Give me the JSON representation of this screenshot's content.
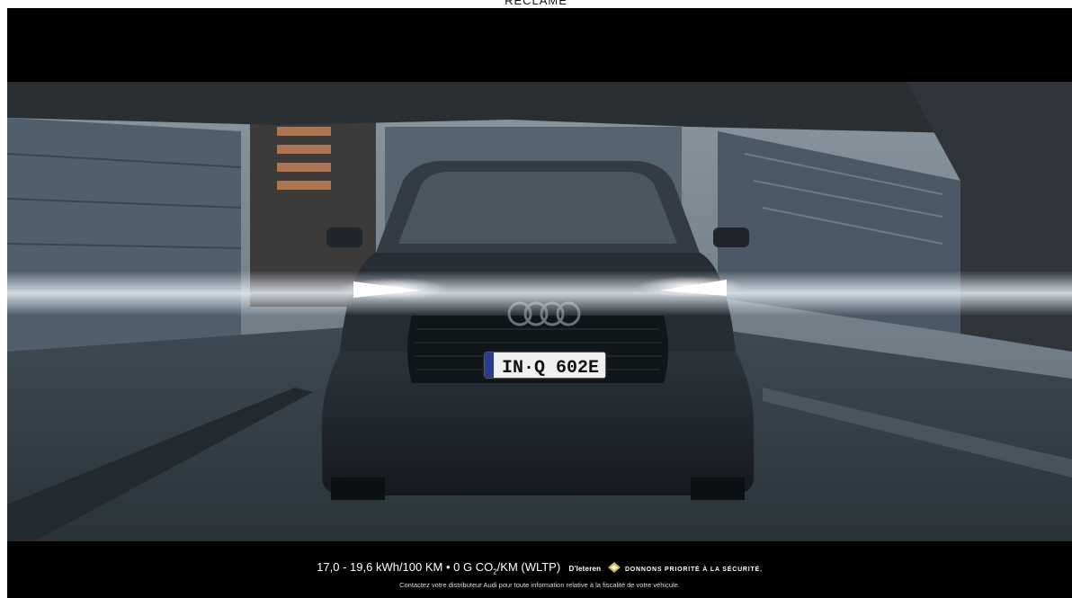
{
  "header": {
    "ad_label": "RECLAME"
  },
  "video": {
    "plate_text": "IN·Q 602E",
    "footer": {
      "spec_prefix": "17,0 - 19,6 kWh/100 KM • 0 G CO",
      "spec_subscript": "2",
      "spec_suffix": "/KM (WLTP)",
      "dealer": "D'Ieteren",
      "slogan": "Donnons priorité à la sécurité.",
      "legal": "Contactez votre distributeur Audi pour toute information relative à la fiscalité de votre véhicule."
    }
  },
  "colors": {
    "letterbox": "#000000",
    "sky": "#6f7f8c",
    "car_body": "#1b2128",
    "headlight_beam": "#e8f0f8",
    "diamond": "#c8b84a"
  },
  "icons": [
    "audi-rings-icon",
    "diamond-icon"
  ]
}
